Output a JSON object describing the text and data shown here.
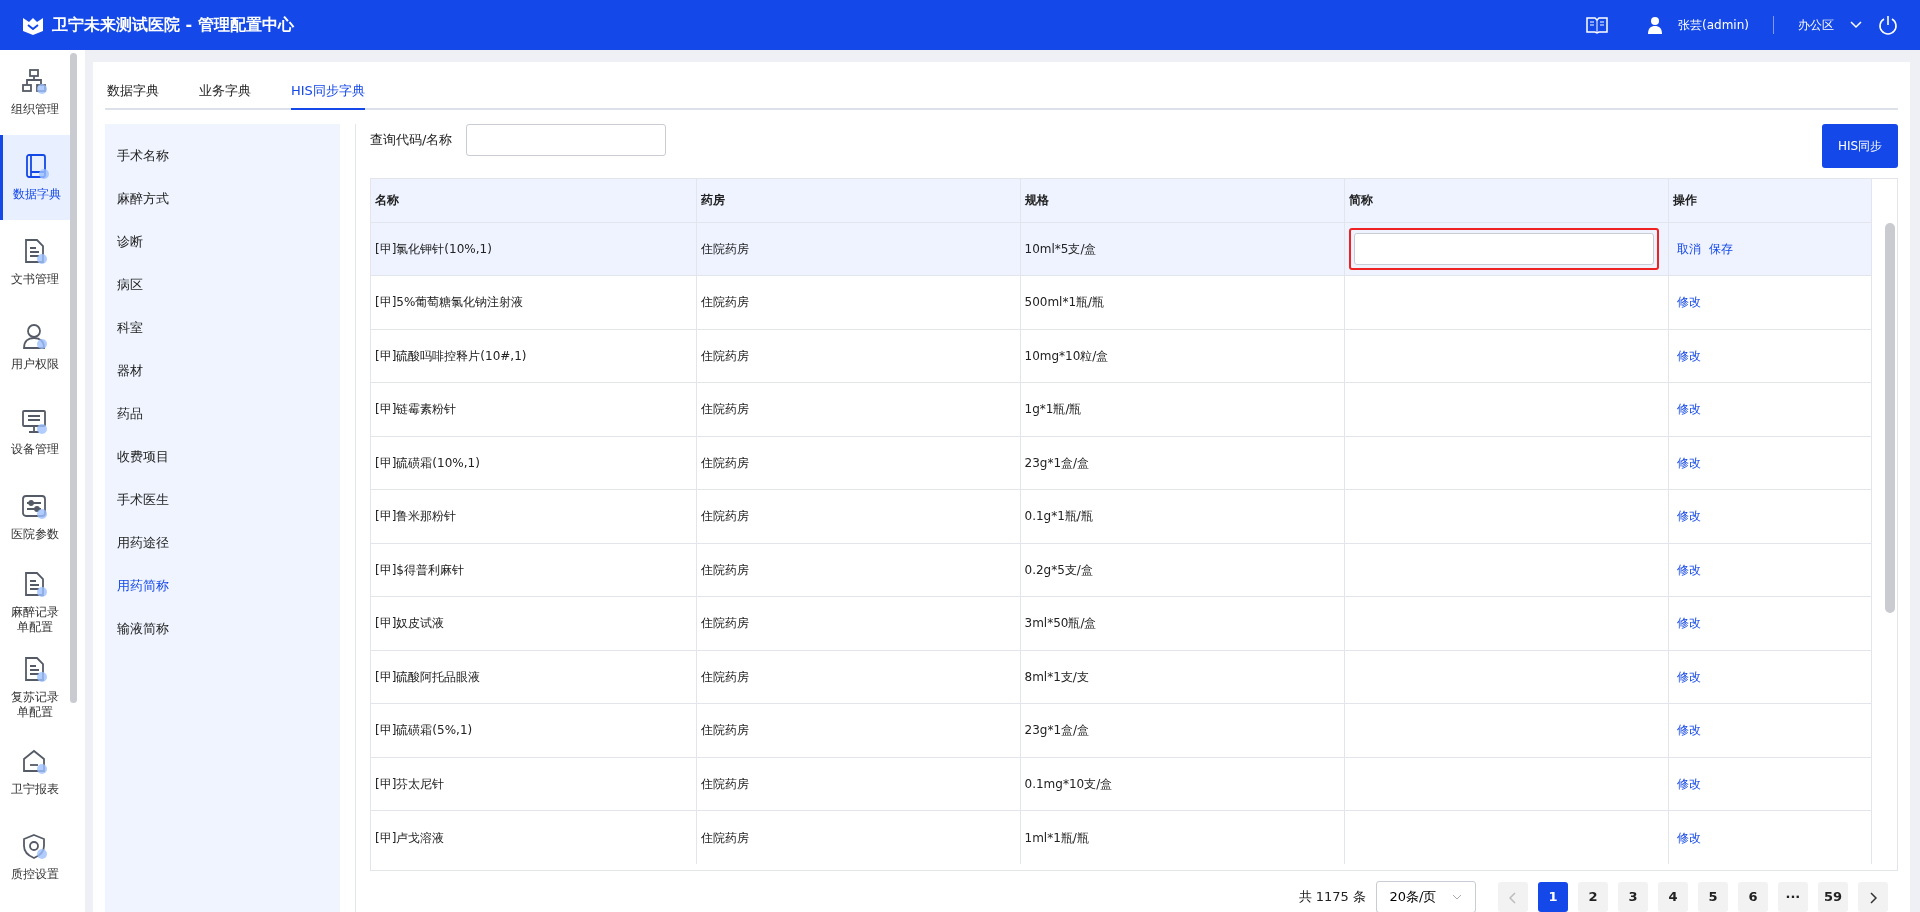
{
  "header": {
    "title": "卫宁未来测试医院 - 管理配置中心",
    "user": "张芸(admin)",
    "workspace": "办公区"
  },
  "sidebar": {
    "items": [
      {
        "label": "组织管理",
        "selected": false
      },
      {
        "label": "数据字典",
        "selected": true
      },
      {
        "label": "文书管理",
        "selected": false
      },
      {
        "label": "用户权限",
        "selected": false
      },
      {
        "label": "设备管理",
        "selected": false
      },
      {
        "label": "医院参数",
        "selected": false
      },
      {
        "label": "麻醉记录单配置",
        "selected": false
      },
      {
        "label": "复苏记录单配置",
        "selected": false
      },
      {
        "label": "卫宁报表",
        "selected": false
      },
      {
        "label": "质控设置",
        "selected": false
      }
    ]
  },
  "tabs": [
    {
      "label": "数据字典",
      "selected": false
    },
    {
      "label": "业务字典",
      "selected": false
    },
    {
      "label": "HIS同步字典",
      "selected": true
    }
  ],
  "categories": [
    {
      "label": "手术名称",
      "selected": false
    },
    {
      "label": "麻醉方式",
      "selected": false
    },
    {
      "label": "诊断",
      "selected": false
    },
    {
      "label": "病区",
      "selected": false
    },
    {
      "label": "科室",
      "selected": false
    },
    {
      "label": "器材",
      "selected": false
    },
    {
      "label": "药品",
      "selected": false
    },
    {
      "label": "收费项目",
      "selected": false
    },
    {
      "label": "手术医生",
      "selected": false
    },
    {
      "label": "用药途径",
      "selected": false
    },
    {
      "label": "用药简称",
      "selected": true
    },
    {
      "label": "输液简称",
      "selected": false
    }
  ],
  "search": {
    "label": "查询代码/名称"
  },
  "sync_button": "HIS同步",
  "table": {
    "columns": [
      "名称",
      "药房",
      "规格",
      "简称",
      "操作"
    ],
    "rows": [
      {
        "name": "[甲]氯化钾针(10%,1)",
        "pharmacy": "住院药房",
        "spec": "10ml*5支/盒",
        "editing": true,
        "actions": [
          "取消",
          "保存"
        ]
      },
      {
        "name": "[甲]5%葡萄糖氯化钠注射液",
        "pharmacy": "住院药房",
        "spec": "500ml*1瓶/瓶",
        "editing": false,
        "actions": [
          "修改"
        ]
      },
      {
        "name": "[甲]硫酸吗啡控释片(10#,1)",
        "pharmacy": "住院药房",
        "spec": "10mg*10粒/盒",
        "editing": false,
        "actions": [
          "修改"
        ]
      },
      {
        "name": "[甲]链霉素粉针",
        "pharmacy": "住院药房",
        "spec": "1g*1瓶/瓶",
        "editing": false,
        "actions": [
          "修改"
        ]
      },
      {
        "name": "[甲]硫磺霜(10%,1)",
        "pharmacy": "住院药房",
        "spec": "23g*1盒/盒",
        "editing": false,
        "actions": [
          "修改"
        ]
      },
      {
        "name": "[甲]鲁米那粉针",
        "pharmacy": "住院药房",
        "spec": "0.1g*1瓶/瓶",
        "editing": false,
        "actions": [
          "修改"
        ]
      },
      {
        "name": "[甲]$得普利麻针",
        "pharmacy": "住院药房",
        "spec": "0.2g*5支/盒",
        "editing": false,
        "actions": [
          "修改"
        ]
      },
      {
        "name": "[甲]奴皮试液",
        "pharmacy": "住院药房",
        "spec": "3ml*50瓶/盒",
        "editing": false,
        "actions": [
          "修改"
        ]
      },
      {
        "name": "[甲]硫酸阿托品眼液",
        "pharmacy": "住院药房",
        "spec": "8ml*1支/支",
        "editing": false,
        "actions": [
          "修改"
        ]
      },
      {
        "name": "[甲]硫磺霜(5%,1)",
        "pharmacy": "住院药房",
        "spec": "23g*1盒/盒",
        "editing": false,
        "actions": [
          "修改"
        ]
      },
      {
        "name": "[甲]芬太尼针",
        "pharmacy": "住院药房",
        "spec": "0.1mg*10支/盒",
        "editing": false,
        "actions": [
          "修改"
        ]
      },
      {
        "name": "[甲]卢戈溶液",
        "pharmacy": "住院药房",
        "spec": "1ml*1瓶/瓶",
        "editing": false,
        "actions": [
          "修改"
        ]
      }
    ]
  },
  "pagination": {
    "total": "共 1175 条",
    "page_size": "20条/页",
    "pages": [
      {
        "label": "1",
        "selected": true
      },
      {
        "label": "2",
        "selected": false
      },
      {
        "label": "3",
        "selected": false
      },
      {
        "label": "4",
        "selected": false
      },
      {
        "label": "5",
        "selected": false
      },
      {
        "label": "6",
        "selected": false
      },
      {
        "label": "···",
        "selected": false
      },
      {
        "label": "59",
        "selected": false
      }
    ]
  }
}
